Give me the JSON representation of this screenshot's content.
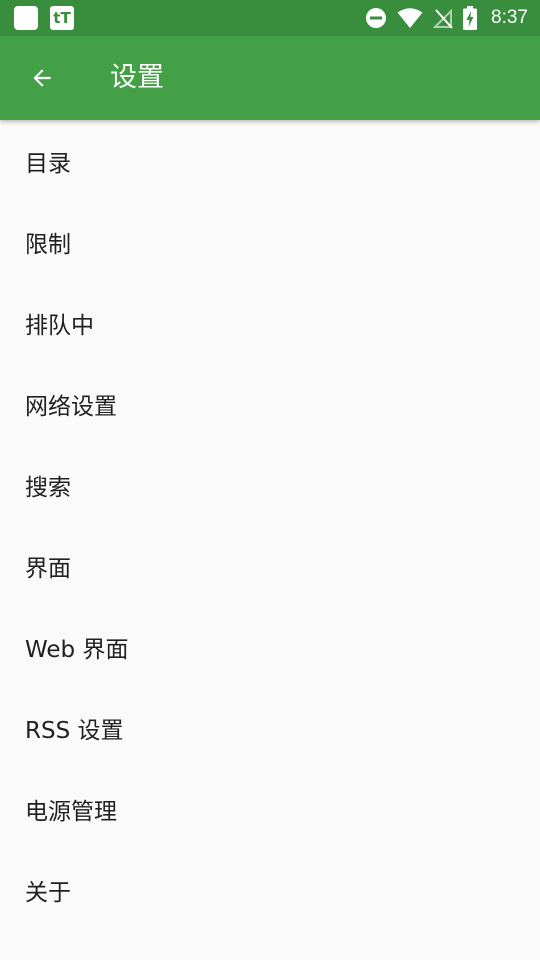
{
  "status_bar": {
    "time": "8:37",
    "icons": [
      "notification-square-icon",
      "tt-app-icon",
      "do-not-disturb-icon",
      "wifi-icon",
      "no-signal-icon",
      "battery-charging-icon"
    ],
    "tt_label": "tT"
  },
  "app_bar": {
    "title": "设置",
    "back_icon": "arrow-left-icon",
    "color": "#43a047",
    "status_color": "#388e3c"
  },
  "menu": {
    "items": [
      {
        "label": "目录"
      },
      {
        "label": "限制"
      },
      {
        "label": "排队中"
      },
      {
        "label": "网络设置"
      },
      {
        "label": "搜索"
      },
      {
        "label": "界面"
      },
      {
        "label": "Web 界面"
      },
      {
        "label": "RSS 设置"
      },
      {
        "label": "电源管理"
      },
      {
        "label": "关于"
      }
    ]
  }
}
